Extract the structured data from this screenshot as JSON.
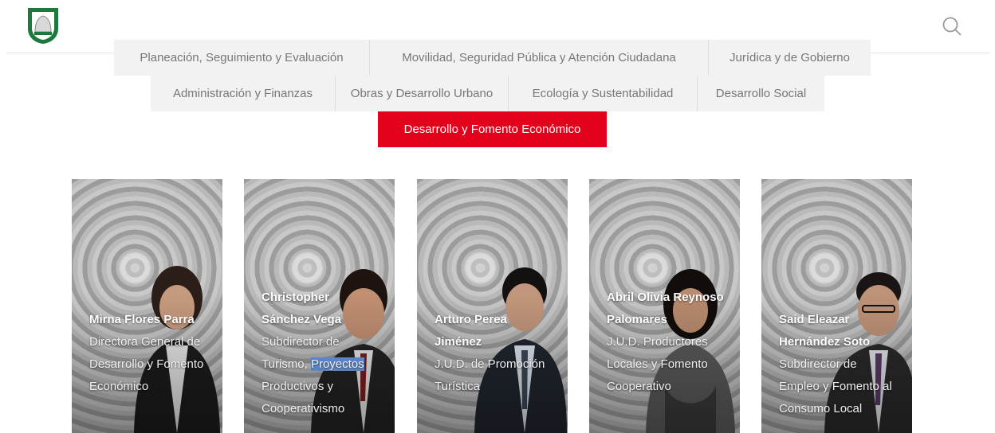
{
  "nav": {
    "rows": [
      {
        "tabs": [
          {
            "label": "Planeación, Seguimiento y Evaluación"
          },
          {
            "label": "Movilidad, Seguridad Pública y Atención Ciudadana"
          },
          {
            "label": "Jurídica y de Gobierno"
          }
        ]
      },
      {
        "tabs": [
          {
            "label": "Administración y Finanzas"
          },
          {
            "label": "Obras y Desarrollo Urbano"
          },
          {
            "label": "Ecología y Sustentabilidad"
          },
          {
            "label": "Desarrollo Social"
          }
        ]
      },
      {
        "tabs": [
          {
            "label": "Desarrollo y Fomento Económico",
            "active": true
          }
        ]
      }
    ]
  },
  "cards": [
    {
      "name": "Mirna Flores Parra",
      "role": "Directora General de Desarrollo y Fomento Económico"
    },
    {
      "name": "Christopher Sánchez Vega",
      "role_before": "Subdirector de Turismo, ",
      "role_highlight": "Proyectos",
      "role_after": " Productivos y Cooperativismo"
    },
    {
      "name": "Arturo Perea Jiménez",
      "role": "J.U.D. de Promoción Turística"
    },
    {
      "name": "Abril Olivia Reynoso Palomares",
      "role": "J.U.D. Productores Locales y Fomento Cooperativo"
    },
    {
      "name": "Said Eleazar Hernández Soto",
      "role": "Subdirector de Empleo y Fomento al Consumo Local"
    }
  ],
  "colors": {
    "accent": "#e3001b",
    "logo_green": "#1c7a3a",
    "tab_bg": "#f2f2f2"
  }
}
